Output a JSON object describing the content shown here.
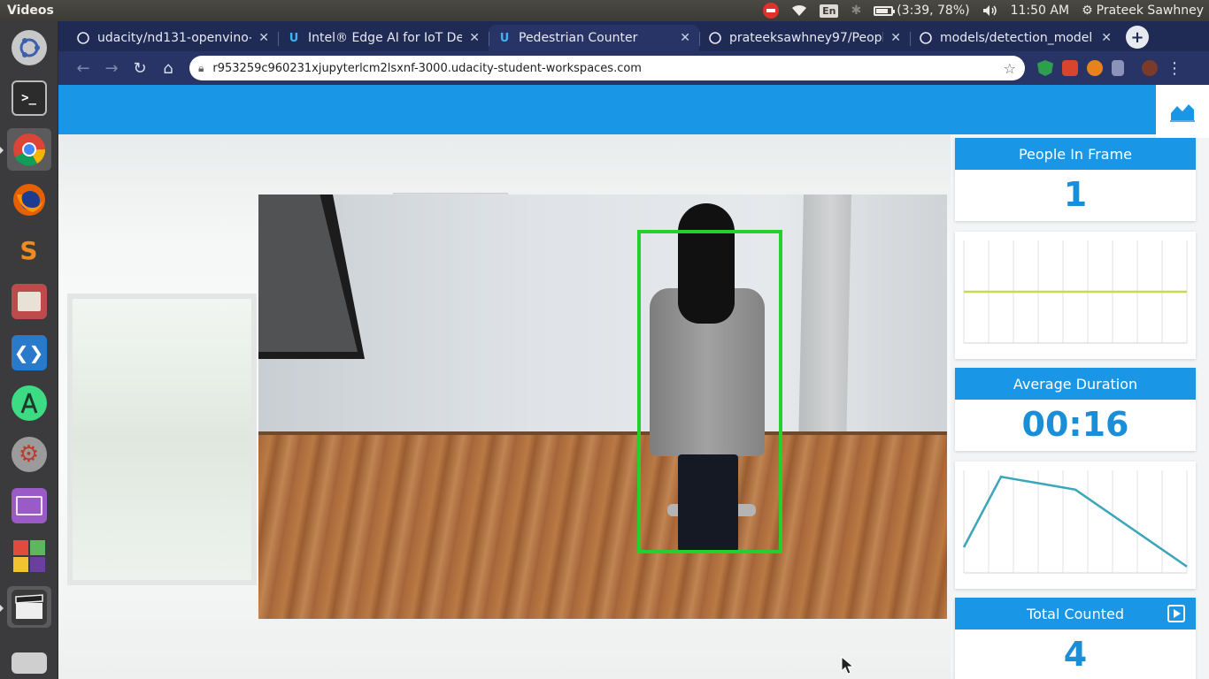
{
  "top_panel": {
    "app_title": "Videos",
    "battery_text": "(3:39, 78%)",
    "keyboard_layout": "En",
    "time": "11:50 AM",
    "user_name": "Prateek Sawhney"
  },
  "launcher": {
    "items": [
      {
        "name": "ubuntu-dash",
        "color": "#d3d3d3"
      },
      {
        "name": "terminal",
        "color": "#2c2c2c"
      },
      {
        "name": "chrome",
        "color": "#e9b949"
      },
      {
        "name": "firefox",
        "color": "#e66000"
      },
      {
        "name": "sublime-text",
        "color": "#f28a1d"
      },
      {
        "name": "files",
        "color": "#bd4b4b"
      },
      {
        "name": "vscode",
        "color": "#2a7acc"
      },
      {
        "name": "android-studio",
        "color": "#3ddc84"
      },
      {
        "name": "system-settings",
        "color": "#b0b0b0"
      },
      {
        "name": "workspace-switcher",
        "color": "#9a5bc7"
      },
      {
        "name": "software-center",
        "color": "#e04b3a"
      },
      {
        "name": "videos",
        "color": "#555555"
      },
      {
        "name": "drive",
        "color": "#cfcfcf"
      }
    ]
  },
  "browser": {
    "tabs": [
      {
        "title": "udacity/nd131-openvino-f",
        "favicon": "github-icon",
        "active": false
      },
      {
        "title": "Intel® Edge AI for IoT Dev",
        "favicon": "udacity-icon",
        "active": false
      },
      {
        "title": "Pedestrian Counter",
        "favicon": "udacity-icon",
        "active": true
      },
      {
        "title": "prateeksawhney97/Peopl",
        "favicon": "github-icon",
        "active": false
      },
      {
        "title": "models/detection_model",
        "favicon": "github-icon",
        "active": false
      }
    ],
    "url": "r953259c960231xjupyterlcm2lsxnf-3000.udacity-student-workspaces.com"
  },
  "dashboard": {
    "people_in_frame": {
      "label": "People In Frame",
      "value": "1"
    },
    "average_duration": {
      "label": "Average Duration",
      "value": "00:16"
    },
    "total_counted": {
      "label": "Total Counted",
      "value": "4"
    },
    "colors": {
      "accent": "#1a96e6",
      "value_text": "#1a8fd8",
      "detection_box": "#23d12d",
      "flat_line": "#c8d94a",
      "trend_line": "#3aa6b9"
    }
  },
  "people_chart_series": [
    1,
    1,
    1,
    1,
    1,
    1,
    1
  ],
  "duration_chart_series": [
    4,
    15,
    14,
    13,
    9,
    5,
    1
  ]
}
